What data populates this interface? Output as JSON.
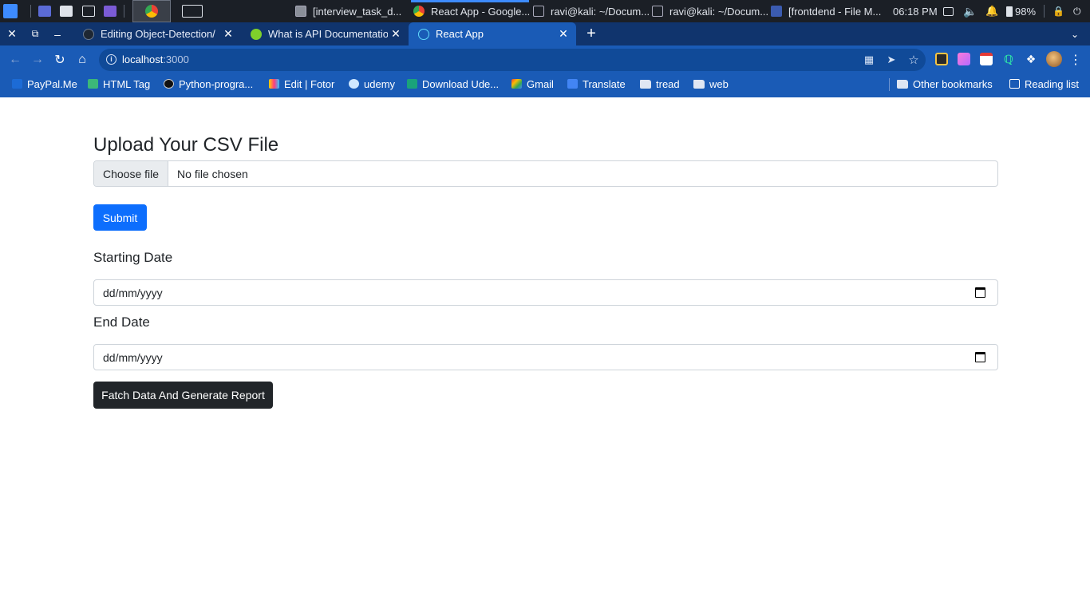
{
  "taskbar": {
    "tasks": [
      {
        "label": "[interview_task_d..."
      },
      {
        "label": "React App - Google..."
      },
      {
        "label": "ravi@kali: ~/Docum..."
      },
      {
        "label": "ravi@kali: ~/Docum..."
      },
      {
        "label": "[frontdend - File M..."
      }
    ],
    "clock": "06:18 PM",
    "battery": "98%"
  },
  "browser": {
    "tabs": [
      {
        "title": "Editing Object-Detection/"
      },
      {
        "title": "What is API Documentatio"
      },
      {
        "title": "React App"
      }
    ],
    "address": {
      "host": "localhost",
      "port": ":3000"
    },
    "bookmarks": [
      {
        "label": "PayPal.Me"
      },
      {
        "label": "HTML Tag"
      },
      {
        "label": "Python-progra..."
      },
      {
        "label": "Edit | Fotor"
      },
      {
        "label": "udemy"
      },
      {
        "label": "Download Ude..."
      },
      {
        "label": "Gmail"
      },
      {
        "label": "Translate"
      },
      {
        "label": "tread"
      },
      {
        "label": "web"
      }
    ],
    "other_bookmarks": "Other bookmarks",
    "reading_list": "Reading list"
  },
  "page": {
    "heading": "Upload Your CSV File",
    "file_button": "Choose file",
    "file_status": "No file chosen",
    "submit_label": "Submit",
    "start_label": "Starting Date",
    "start_placeholder": "dd/mm/yyyy",
    "end_label": "End Date",
    "end_placeholder": "dd/mm/yyyy",
    "fetch_label": "Fatch Data And Generate Report"
  },
  "colors": {
    "tab_strip": "#10346d",
    "toolbar": "#1a5bb6",
    "primary_button": "#0d6efd",
    "dark_button": "#212529"
  }
}
